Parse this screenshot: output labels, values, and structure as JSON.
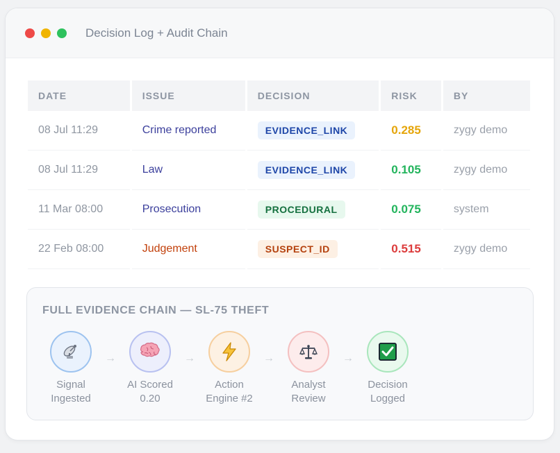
{
  "window": {
    "title": "Decision Log + Audit Chain"
  },
  "table": {
    "headers": [
      "DATE",
      "ISSUE",
      "DECISION",
      "RISK",
      "BY"
    ],
    "rows": [
      {
        "date": "08 Jul 11:29",
        "issue": "Crime reported",
        "decision": "EVIDENCE_LINK",
        "risk": "0.285",
        "by": "zygy demo"
      },
      {
        "date": "08 Jul 11:29",
        "issue": "Law",
        "decision": "EVIDENCE_LINK",
        "risk": "0.105",
        "by": "zygy demo"
      },
      {
        "date": "11 Mar 08:00",
        "issue": "Prosecution",
        "decision": "PROCEDURAL",
        "risk": "0.075",
        "by": "system"
      },
      {
        "date": "22 Feb 08:00",
        "issue": "Judgement",
        "decision": "SUSPECT_ID",
        "risk": "0.515",
        "by": "zygy demo"
      }
    ]
  },
  "chain": {
    "title": "FULL EVIDENCE CHAIN — SL-75 THEFT",
    "arrow": "→",
    "steps": [
      {
        "line1": "Signal",
        "line2": "Ingested",
        "icon": "satellite-dish-icon"
      },
      {
        "line1": "AI Scored",
        "line2": "0.20",
        "icon": "brain-icon"
      },
      {
        "line1": "Action",
        "line2": "Engine #2",
        "icon": "lightning-icon"
      },
      {
        "line1": "Analyst",
        "line2": "Review",
        "icon": "scales-icon"
      },
      {
        "line1": "Decision",
        "line2": "Logged",
        "icon": "check-box-icon"
      }
    ]
  },
  "colors": {
    "risk_medium": "#e5a50a",
    "risk_low": "#22b45c",
    "risk_high": "#dc3c3c",
    "step_blue": "#9dc3ef",
    "step_purple": "#b8c1f0",
    "step_orange": "#f6cf9f",
    "step_red": "#f4c0c0",
    "step_green": "#a9e6bc"
  }
}
